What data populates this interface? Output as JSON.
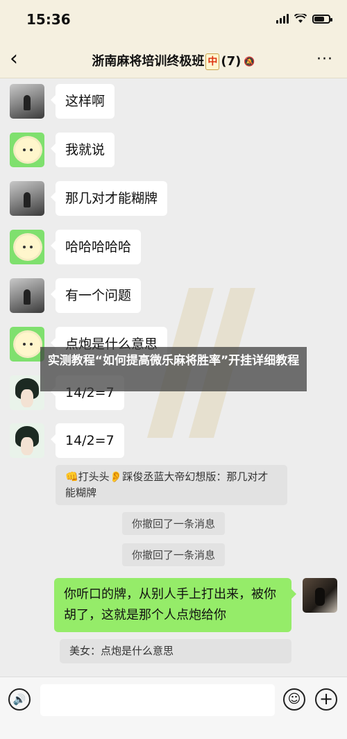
{
  "status_bar": {
    "time": "15:36"
  },
  "nav": {
    "title": "浙南麻将培训终极班",
    "tile_char": "中",
    "member_count": "(7)"
  },
  "messages": [
    {
      "sender": "dark",
      "text": "这样啊"
    },
    {
      "sender": "sheep",
      "text": "我就说"
    },
    {
      "sender": "dark",
      "text": "那几对才能糊牌"
    },
    {
      "sender": "sheep",
      "text": "哈哈哈哈哈"
    },
    {
      "sender": "dark",
      "text": "有一个问题"
    },
    {
      "sender": "sheep",
      "text": "点炮是什么意思"
    },
    {
      "sender": "anime",
      "text": "14/2=7"
    },
    {
      "sender": "anime",
      "text": "14/2=7"
    }
  ],
  "quote_incoming": {
    "text": "👊打头头👂踩俊丞蓝大帝幻想版：那几对才能糊牌"
  },
  "recalls": [
    "你撤回了一条消息",
    "你撤回了一条消息"
  ],
  "self_message": {
    "text": "你听口的牌，从别人手上打出来，被你胡了，这就是那个人点炮给你"
  },
  "quote_outgoing": {
    "text": "美女：点炮是什么意思"
  },
  "overlay": {
    "text": "实测教程“如何提高微乐麻将胜率”开挂详细教程"
  }
}
